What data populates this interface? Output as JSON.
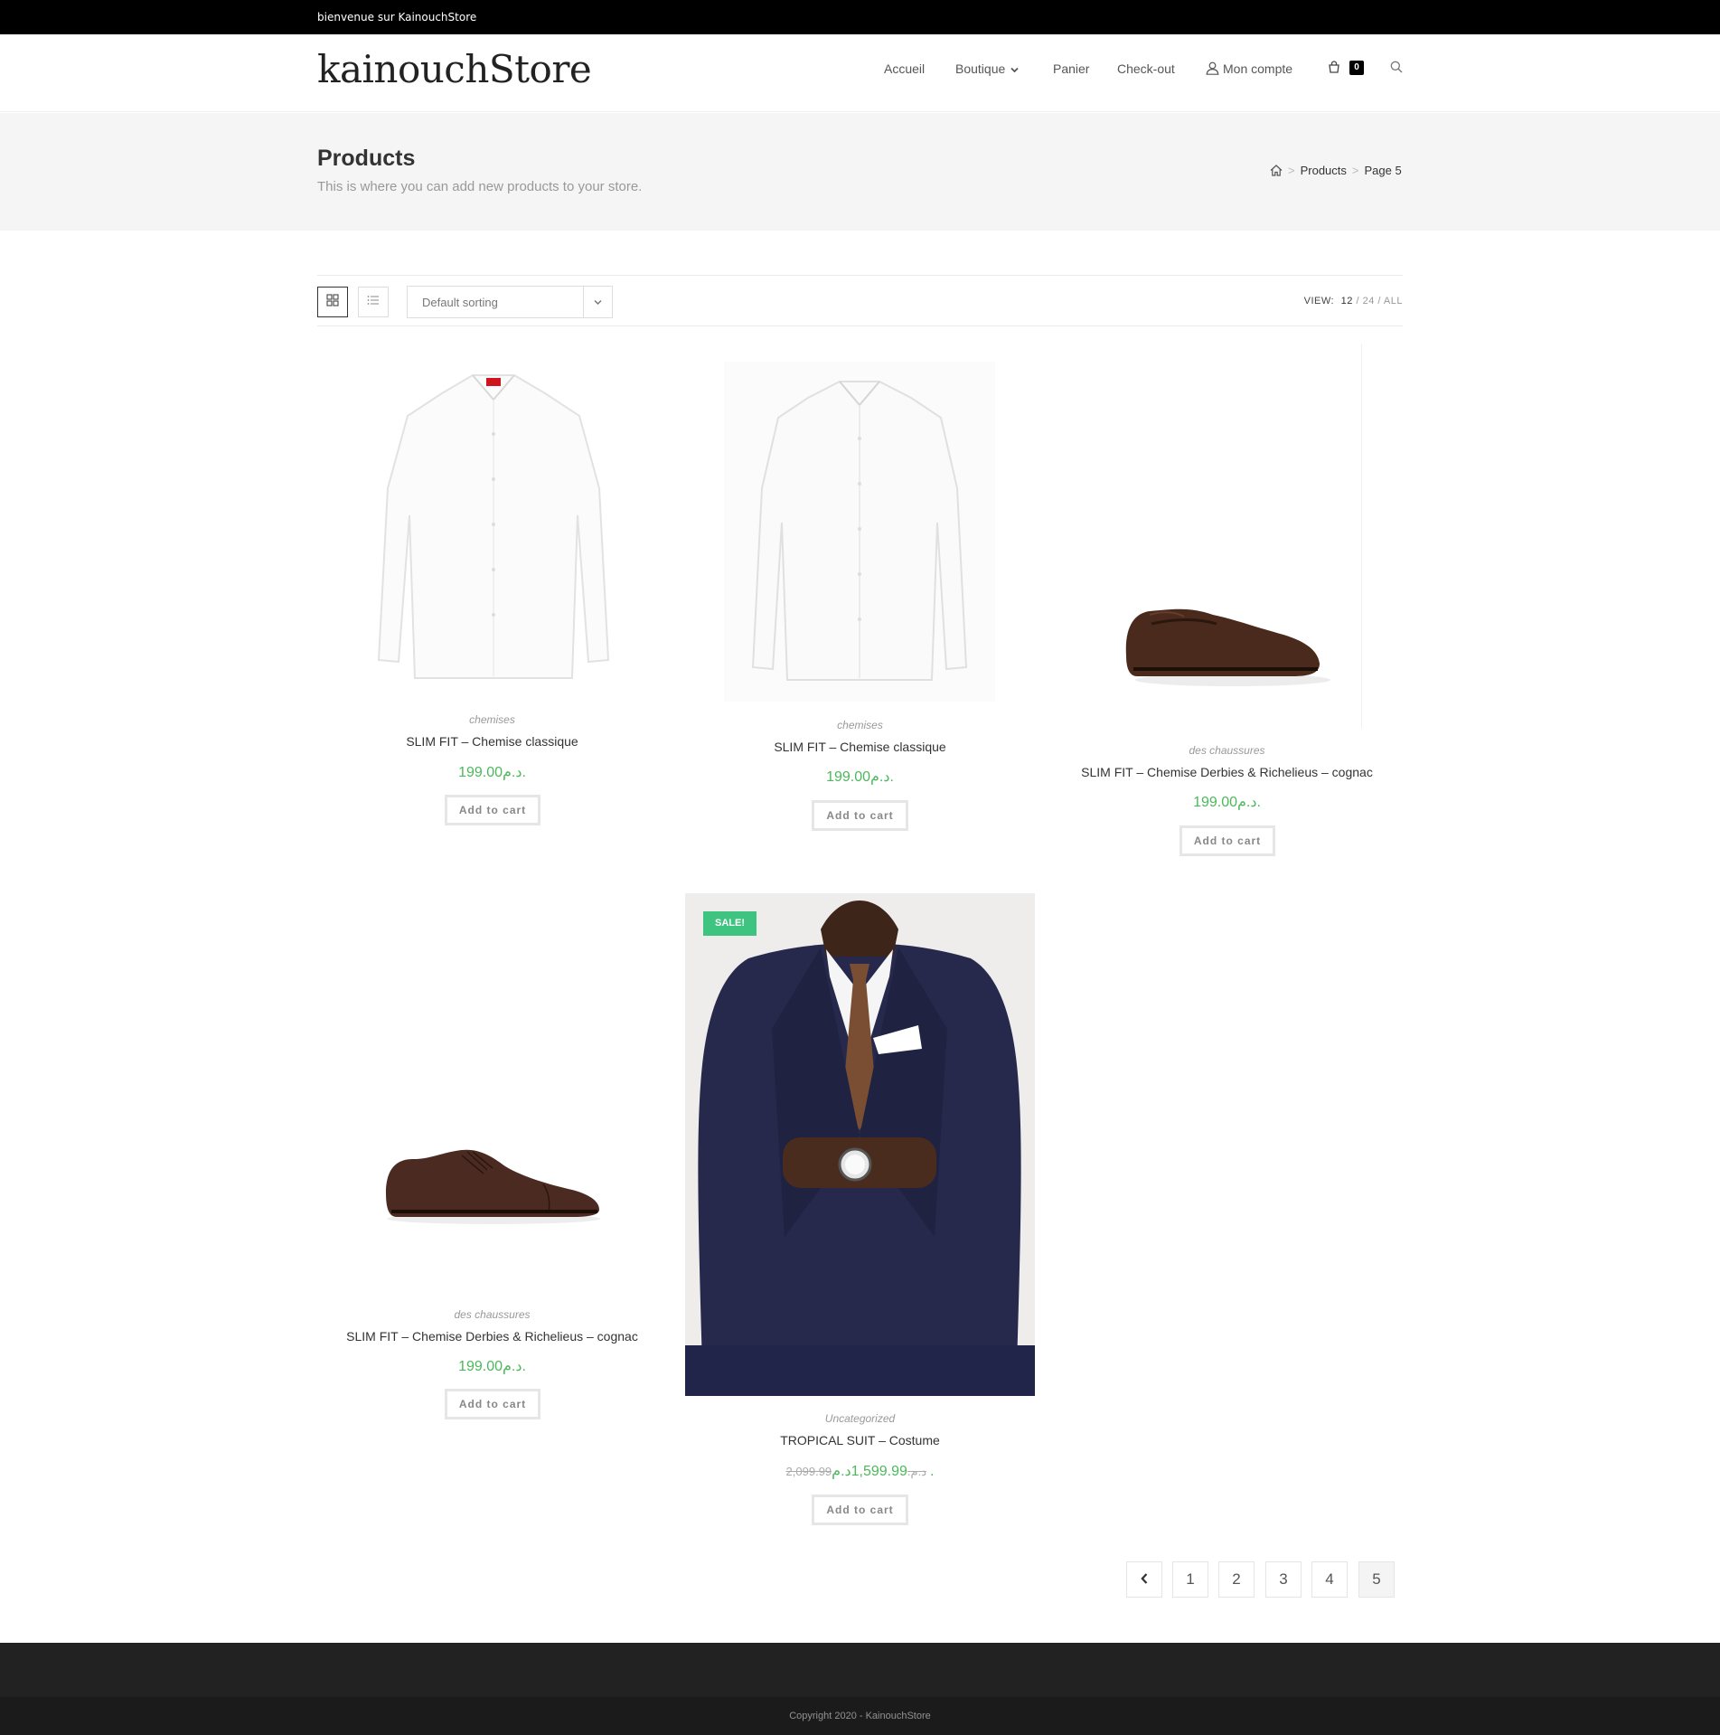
{
  "topbar": {
    "text": "bienvenue sur KainouchStore"
  },
  "header": {
    "logo": "kainouchStore",
    "nav": {
      "accueil": "Accueil",
      "boutique": "Boutique",
      "panier": "Panier",
      "checkout": "Check-out",
      "account": "Mon compte",
      "cart_count": "0"
    }
  },
  "page": {
    "title": "Products",
    "subtitle": "This is where you can add new products to your store.",
    "breadcrumb": {
      "products": "Products",
      "current": "Page 5"
    }
  },
  "toolbar": {
    "sort": "Default sorting",
    "view_label": "VIEW:",
    "view_12": "12",
    "view_24": "24",
    "view_all": "ALL",
    "sep": "/"
  },
  "products": [
    {
      "category": "chemises",
      "name": "SLIM FIT – Chemise classique",
      "price": "199.00د.م.",
      "button": "Add to cart",
      "image": "white-shirt"
    },
    {
      "category": "chemises",
      "name": "SLIM FIT – Chemise classique",
      "price": "199.00د.م.",
      "button": "Add to cart",
      "image": "white-shirt"
    },
    {
      "category": "des chaussures",
      "name": "SLIM FIT – Chemise Derbies & Richelieus – cognac",
      "price": "199.00د.م.",
      "button": "Add to cart",
      "image": "brown-loafer"
    },
    {
      "category": "des chaussures",
      "name": "SLIM FIT – Chemise Derbies & Richelieus – cognac",
      "price": "199.00د.م.",
      "button": "Add to cart",
      "image": "brown-oxford"
    },
    {
      "category": "Uncategorized",
      "name": "TROPICAL SUIT – Costume",
      "old_price": "2,099.99د.م.",
      "price": "1,599.99د.م.",
      "button": "Add to cart",
      "badge": "SALE!",
      "image": "navy-suit-photo"
    }
  ],
  "pagination": {
    "prev": "‹",
    "pages": [
      "1",
      "2",
      "3",
      "4",
      "5"
    ],
    "current": "5"
  },
  "footer": {
    "copyright": "Copyright 2020 - KainouchStore"
  },
  "colors": {
    "accent_price": "#4cb85c",
    "sale_badge": "#3fc380",
    "topbar": "#000000",
    "footer": "#222222"
  }
}
